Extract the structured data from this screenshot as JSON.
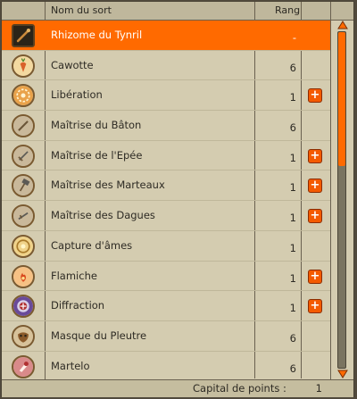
{
  "header": {
    "col_name": "Nom du sort",
    "col_rank": "Rang"
  },
  "spells": [
    {
      "name": "Rhizome du Tynril",
      "rank": "-",
      "upgradable": false,
      "selected": true,
      "icon": "staff-icon"
    },
    {
      "name": "Cawotte",
      "rank": "6",
      "upgradable": false,
      "selected": false,
      "icon": "carrot-icon"
    },
    {
      "name": "Libération",
      "rank": "1",
      "upgradable": true,
      "selected": false,
      "icon": "liberation-icon"
    },
    {
      "name": "Maîtrise du Bâton",
      "rank": "6",
      "upgradable": false,
      "selected": false,
      "icon": "staff-mastery-icon"
    },
    {
      "name": "Maîtrise de l'Epée",
      "rank": "1",
      "upgradable": true,
      "selected": false,
      "icon": "sword-mastery-icon"
    },
    {
      "name": "Maîtrise des Marteaux",
      "rank": "1",
      "upgradable": true,
      "selected": false,
      "icon": "hammer-mastery-icon"
    },
    {
      "name": "Maîtrise des Dagues",
      "rank": "1",
      "upgradable": true,
      "selected": false,
      "icon": "dagger-mastery-icon"
    },
    {
      "name": "Capture d'âmes",
      "rank": "1",
      "upgradable": false,
      "selected": false,
      "icon": "soul-capture-icon"
    },
    {
      "name": "Flamiche",
      "rank": "1",
      "upgradable": true,
      "selected": false,
      "icon": "flame-icon"
    },
    {
      "name": "Diffraction",
      "rank": "1",
      "upgradable": true,
      "selected": false,
      "icon": "diffraction-icon"
    },
    {
      "name": "Masque du Pleutre",
      "rank": "6",
      "upgradable": false,
      "selected": false,
      "icon": "mask-icon"
    },
    {
      "name": "Martelo",
      "rank": "6",
      "upgradable": false,
      "selected": false,
      "icon": "martelo-icon"
    }
  ],
  "plus_label": "+",
  "footer": {
    "label": "Capital de points :",
    "value": "1"
  },
  "colors": {
    "accent": "#ff6a00",
    "panel": "#d4ccb0",
    "border": "#514a3d"
  }
}
